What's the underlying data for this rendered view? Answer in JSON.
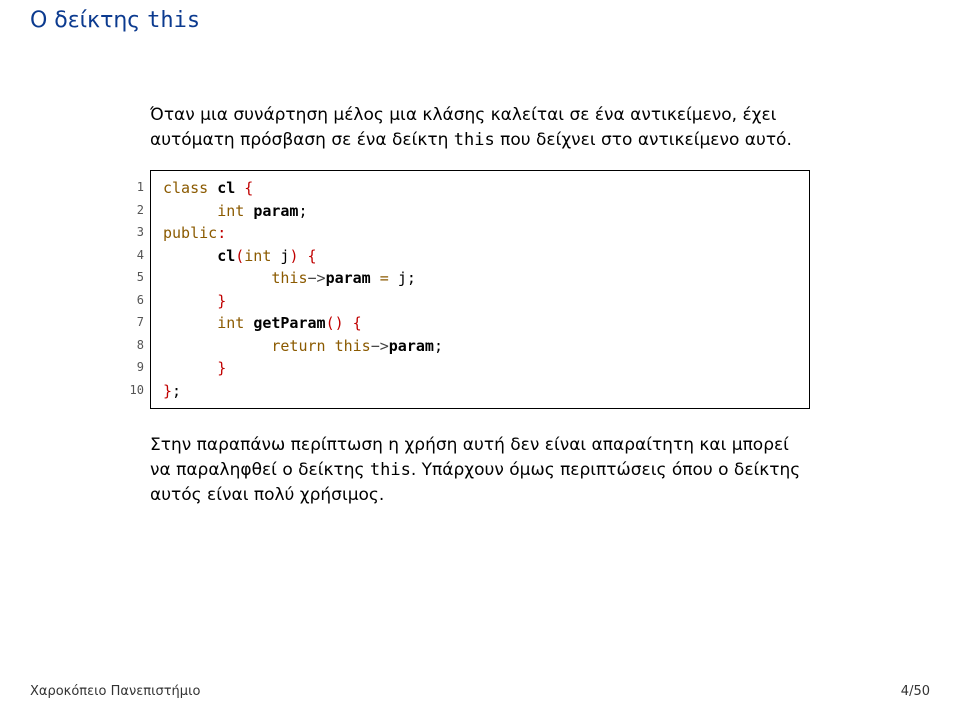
{
  "title": {
    "prefix": "Ο δείκτης ",
    "keyword": "this"
  },
  "para1": {
    "t1": "Όταν μια συνάρτηση μέλος μια κλάσης καλείται σε ένα αντικείμενο, έχει αυτόματη πρόσβαση σε ένα δείκτη ",
    "kw": "this",
    "t2": " που δείχνει στο αντικείμενο αυτό."
  },
  "code": {
    "line_numbers": [
      "1",
      "2",
      "3",
      "4",
      "5",
      "6",
      "7",
      "8",
      "9",
      "10"
    ],
    "l1": {
      "kw": "class",
      "sp": " ",
      "id": "cl",
      "sp2": " ",
      "brace": "{"
    },
    "l2": {
      "indent": "      ",
      "type": "int",
      "sp": " ",
      "id": "param",
      "semi": ";"
    },
    "l3": {
      "kw": "public",
      "colon": ":"
    },
    "l4": {
      "indent": "      ",
      "id": "cl",
      "lp": "(",
      "type": "int",
      "sp": " ",
      "arg": "j",
      "rp": ")",
      "sp2": " ",
      "brace": "{"
    },
    "l5": {
      "indent": "            ",
      "kw": "this",
      "arrow": "−>",
      "id": "param",
      "sp": " ",
      "eq": "=",
      "sp2": " ",
      "rhs": "j",
      "semi": ";"
    },
    "l6": {
      "indent": "      ",
      "brace": "}"
    },
    "l7": {
      "indent": "      ",
      "type": "int",
      "sp": " ",
      "id": "getParam",
      "lp": "(",
      "rp": ")",
      "sp2": " ",
      "brace": "{"
    },
    "l8": {
      "indent": "            ",
      "kw": "return",
      "sp": " ",
      "kw2": "this",
      "arrow": "−>",
      "id": "param",
      "semi": ";"
    },
    "l9": {
      "indent": "      ",
      "brace": "}"
    },
    "l10": {
      "brace": "}",
      "semi": ";"
    }
  },
  "para2": {
    "t1": "Στην παραπάνω περίπτωση η χρήση αυτή δεν είναι απαραίτητη και μπορεί να παραληφθεί ο δείκτης ",
    "kw": "this",
    "t2": ". Υπάρχουν όμως περιπτώσεις όπου ο δείκτης αυτός είναι πολύ χρήσιμος."
  },
  "footer": {
    "left": "Χαροκόπειο Πανεπιστήμιο",
    "right": "4/50"
  }
}
